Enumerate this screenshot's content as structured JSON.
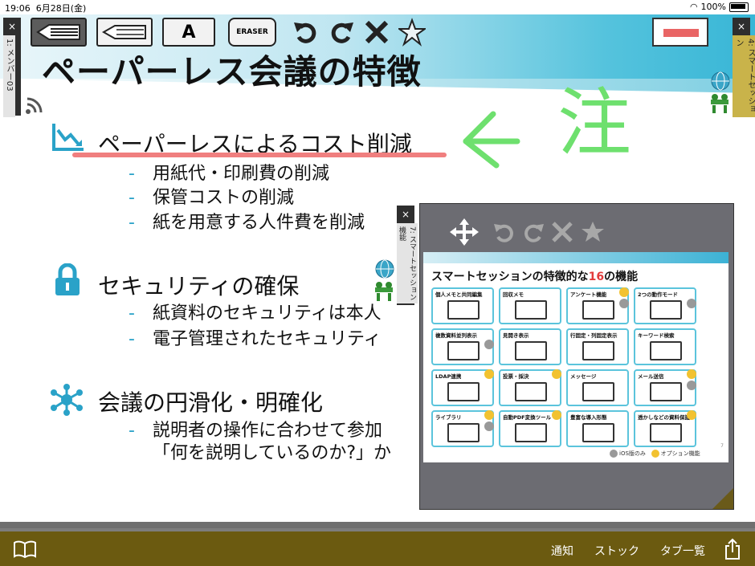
{
  "status": {
    "time": "19:06",
    "date": "6月28日(金)",
    "battery": "100%"
  },
  "toolbar": {
    "font_label": "A",
    "eraser_label": "ERASER"
  },
  "left_tab": {
    "close": "×",
    "label": "1: メンバー03"
  },
  "right_tab": {
    "close": "×",
    "label": "4: スマートセッション"
  },
  "mid_tab": {
    "close": "×",
    "label": "7: スマートセッション機能"
  },
  "slide": {
    "title": "ペーパーレス会議の特徴",
    "handwriting": "注",
    "sections": [
      {
        "icon": "chart-down-icon",
        "heading": "ペーパーレスによるコスト削減",
        "items": [
          "用紙代・印刷費の削減",
          "保管コストの削減",
          "紙を用意する人件費を削減"
        ]
      },
      {
        "icon": "lock-icon",
        "heading": "セキュリティの確保",
        "items": [
          "紙資料のセキュリティは本人",
          "電子管理されたセキュリティ"
        ]
      },
      {
        "icon": "network-icon",
        "heading": "会議の円滑化・明確化",
        "items": [
          "説明者の操作に合わせて参加",
          "「何を説明しているのか?」か"
        ]
      }
    ]
  },
  "popup": {
    "title_prefix": "スマートセッションの特徴的な",
    "title_number": "16",
    "title_suffix": "の機能",
    "page_number": "7",
    "legend_ios": "iOS版のみ",
    "legend_op": "オプション機能",
    "cards": [
      {
        "label": "個人メモと共同編集",
        "op": false,
        "ios": false
      },
      {
        "label": "回収メモ",
        "op": false,
        "ios": false
      },
      {
        "label": "アンケート機能",
        "op": true,
        "ios": true
      },
      {
        "label": "2つの動作モード",
        "op": false,
        "ios": true
      },
      {
        "label": "複数資料並列表示",
        "op": false,
        "ios": true
      },
      {
        "label": "見開き表示",
        "op": false,
        "ios": false
      },
      {
        "label": "行固定・列固定表示",
        "op": false,
        "ios": false
      },
      {
        "label": "キーワード検索",
        "op": false,
        "ios": false
      },
      {
        "label": "LDAP連携",
        "op": true,
        "ios": false
      },
      {
        "label": "投票・採決",
        "op": true,
        "ios": false
      },
      {
        "label": "メッセージ",
        "op": false,
        "ios": false
      },
      {
        "label": "メール送信",
        "op": true,
        "ios": true
      },
      {
        "label": "ライブラリ",
        "op": true,
        "ios": true
      },
      {
        "label": "自動PDF変換ツール",
        "op": true,
        "ios": false
      },
      {
        "label": "豊富な導入形態",
        "op": false,
        "ios": false
      },
      {
        "label": "透かしなどの資料保護",
        "op": true,
        "ios": false
      }
    ]
  },
  "bottom": {
    "notify": "通知",
    "stock": "ストック",
    "tabs": "タブ一覧"
  }
}
